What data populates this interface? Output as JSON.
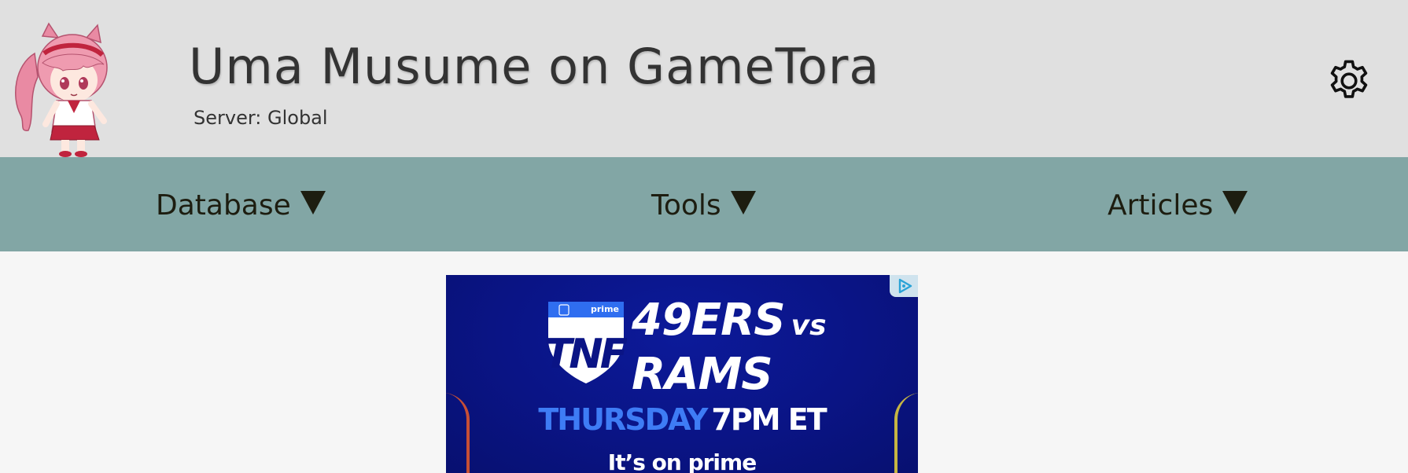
{
  "header": {
    "title": "Uma Musume on GameTora",
    "server_label": "Server: Global",
    "mascot_icon": "chibi-horse-girl-mascot",
    "settings_icon": "gear-icon"
  },
  "nav": {
    "items": [
      {
        "label": "Database",
        "icon": "caret-down-icon"
      },
      {
        "label": "Tools",
        "icon": "caret-down-icon"
      },
      {
        "label": "Articles",
        "icon": "caret-down-icon"
      }
    ]
  },
  "ad": {
    "logo_text": "TNF",
    "brand_text": "prime",
    "team1": "49ERS",
    "vs": "vs",
    "team2": "RAMS",
    "day": "THURSDAY",
    "time": "7PM ET",
    "tagline": "It’s on prime",
    "adchoices_icon": "adchoices-icon"
  },
  "colors": {
    "header_bg": "#e0e0e0",
    "nav_bg": "#82a6a5",
    "page_bg": "#f6f6f6",
    "ad_bg": "#0a1485",
    "ad_accent": "#3e7cf5"
  }
}
